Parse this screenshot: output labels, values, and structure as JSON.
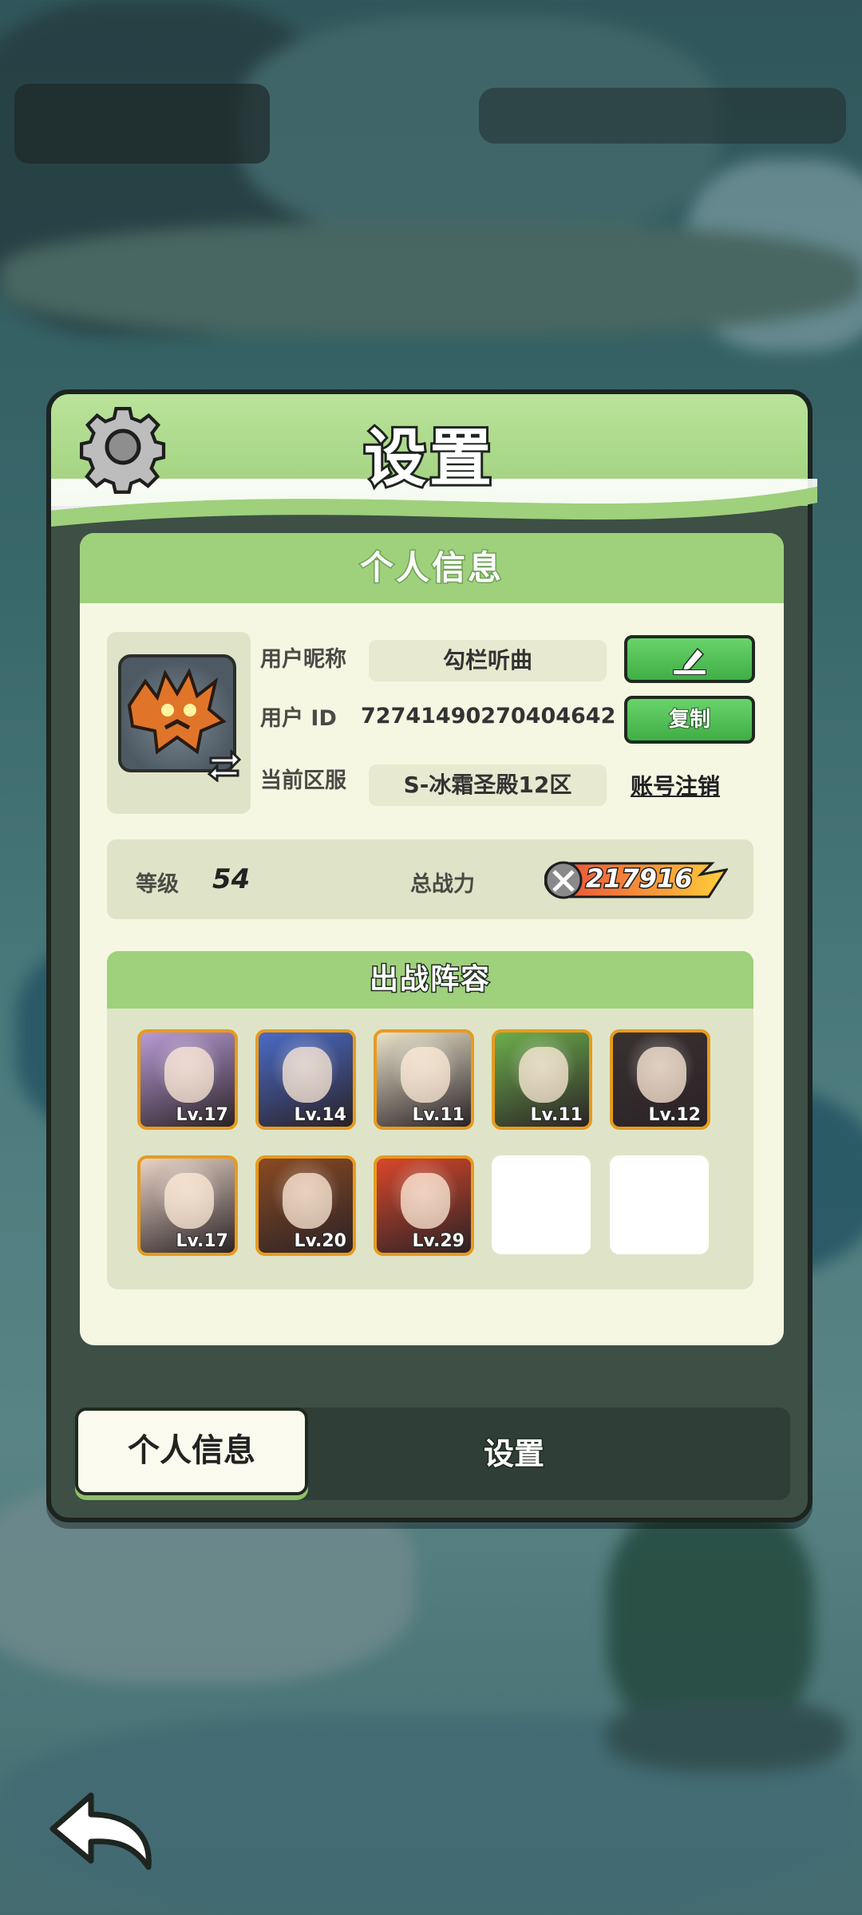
{
  "panel": {
    "title": "设置"
  },
  "profile": {
    "section_title": "个人信息",
    "nickname_label": "用户昵称",
    "nickname": "勾栏听曲",
    "id_label": "用户  ID",
    "user_id": "72741490270404642",
    "copy_label": "复制",
    "server_label": "当前区服",
    "server": "S-冰霜圣殿12区",
    "cancel_account": "账号注销",
    "level_label": "等级",
    "level": "54",
    "power_label": "总战力",
    "power": "217916"
  },
  "team": {
    "title": "出战阵容",
    "heroes": [
      {
        "lv": "Lv.17",
        "color": "#b99bd6"
      },
      {
        "lv": "Lv.14",
        "color": "#4a6bc7"
      },
      {
        "lv": "Lv.11",
        "color": "#e8e2c9"
      },
      {
        "lv": "Lv.11",
        "color": "#6cae4b"
      },
      {
        "lv": "Lv.12",
        "color": "#3a3230"
      },
      {
        "lv": "Lv.17",
        "color": "#e9d3c5"
      },
      {
        "lv": "Lv.20",
        "color": "#8a4a22"
      },
      {
        "lv": "Lv.29",
        "color": "#d9472a"
      }
    ]
  },
  "tabs": {
    "active": "个人信息",
    "other": "设置"
  },
  "colors": {
    "accent_green": "#9fd07c",
    "button_green": "#3fae45",
    "hero_border": "#e79b1e",
    "power_gradient_end": "#ffcf3a"
  }
}
